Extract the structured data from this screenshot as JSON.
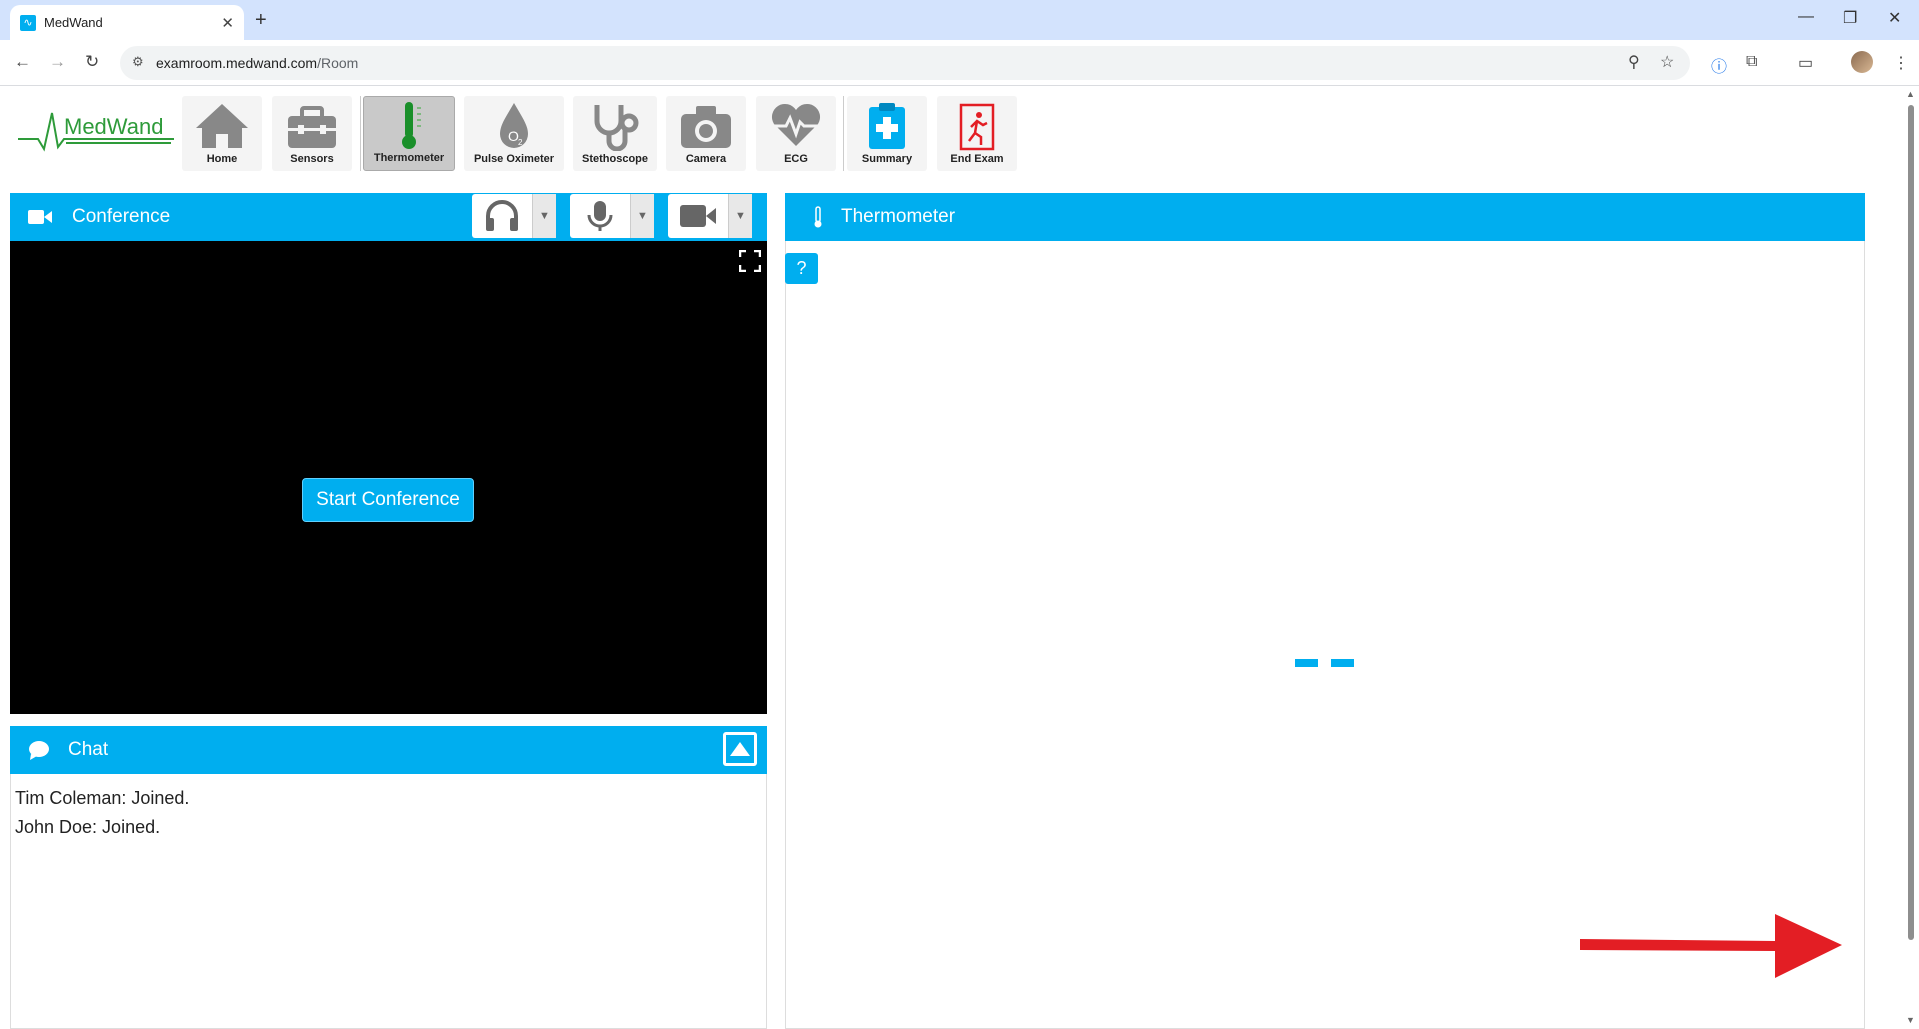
{
  "browser": {
    "tab_title": "MedWand",
    "url_host": "examroom.medwand.com",
    "url_path": "/Room"
  },
  "app": {
    "logo_text": "MedWand",
    "nav": [
      {
        "label": "Home",
        "icon": "home-icon"
      },
      {
        "label": "Sensors",
        "icon": "toolbox-icon"
      },
      {
        "label": "Thermometer",
        "icon": "thermometer-icon",
        "active": true
      },
      {
        "label": "Pulse Oximeter",
        "icon": "o2-drop-icon"
      },
      {
        "label": "Stethoscope",
        "icon": "stethoscope-icon"
      },
      {
        "label": "Camera",
        "icon": "camera-icon"
      },
      {
        "label": "ECG",
        "icon": "heart-pulse-icon"
      },
      {
        "label": "Summary",
        "icon": "clipboard-plus-icon"
      },
      {
        "label": "End Exam",
        "icon": "exit-icon"
      }
    ],
    "conference": {
      "title": "Conference",
      "start_label": "Start Conference"
    },
    "chat": {
      "title": "Chat",
      "messages": [
        "Tim Coleman: Joined.",
        "John Doe: Joined."
      ]
    },
    "thermometer": {
      "title": "Thermometer",
      "help_label": "?"
    }
  },
  "colors": {
    "accent": "#00aeef",
    "active_nav": "#c9c9c9",
    "annotation_arrow": "#e31e24"
  }
}
